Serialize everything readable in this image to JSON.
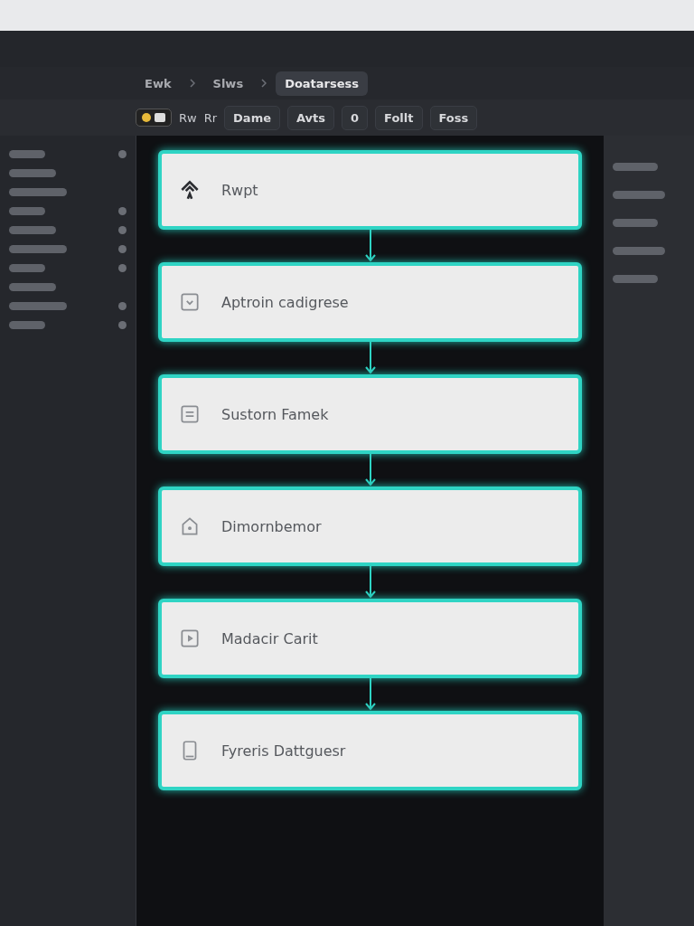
{
  "breadcrumbs": [
    {
      "label": "Ewk",
      "selected": false
    },
    {
      "label": "Slws",
      "selected": false
    },
    {
      "label": "Doatarsess",
      "selected": true
    }
  ],
  "toolbar": {
    "labels": [
      "Rw",
      "Rr"
    ],
    "buttons": [
      "Dame",
      "Avts",
      "0",
      "Follt",
      "Foss"
    ]
  },
  "sidebar": {
    "rows": [
      {
        "dot": true
      },
      {
        "dot": false
      },
      {
        "dot": false
      },
      {
        "dot": true
      },
      {
        "dot": true
      },
      {
        "dot": true
      },
      {
        "dot": true
      },
      {
        "dot": false
      },
      {
        "dot": true
      },
      {
        "dot": true
      }
    ]
  },
  "steps": [
    {
      "label": "Rwpt",
      "kind": "logo"
    },
    {
      "label": "Aptroin cadigrese",
      "kind": "check"
    },
    {
      "label": "Sustorn Famek",
      "kind": "list"
    },
    {
      "label": "Dimornbemor",
      "kind": "house"
    },
    {
      "label": "Madacir Carit",
      "kind": "play"
    },
    {
      "label": "Fyreris Dattguesr",
      "kind": "tablet"
    }
  ]
}
